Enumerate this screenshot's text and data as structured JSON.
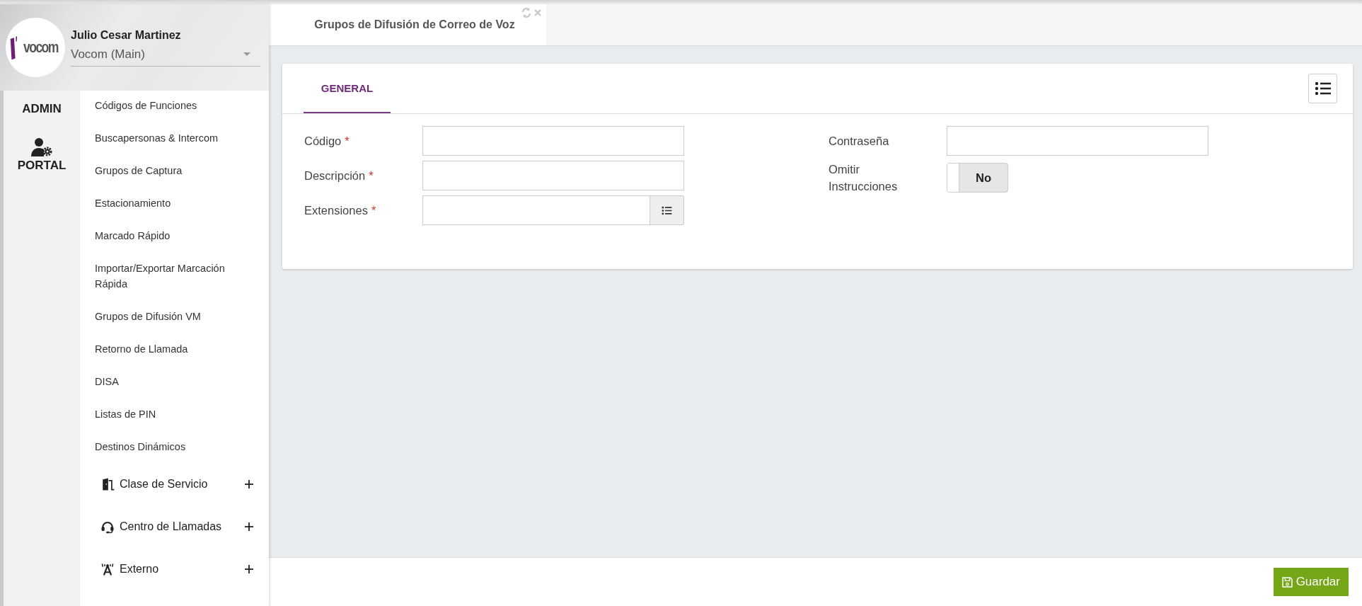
{
  "user": {
    "logo_text": "vocom",
    "name": "Julio Cesar Martinez",
    "account": "Vocom (Main)"
  },
  "rail": [
    {
      "label": "ADMIN",
      "kind": "admin"
    },
    {
      "label": "PORTAL",
      "kind": "portal"
    }
  ],
  "menu": [
    {
      "label": "Códigos de Funciones",
      "kind": "link"
    },
    {
      "label": "Buscapersonas & Intercom",
      "kind": "link"
    },
    {
      "label": "Grupos de Captura",
      "kind": "link"
    },
    {
      "label": "Estacionamiento",
      "kind": "link"
    },
    {
      "label": "Marcado Rápido",
      "kind": "link"
    },
    {
      "label": "Importar/Exportar Marcación Rápida",
      "kind": "link"
    },
    {
      "label": "Grupos de Difusión VM",
      "kind": "link"
    },
    {
      "label": "Retorno de Llamada",
      "kind": "link"
    },
    {
      "label": "DISA",
      "kind": "link"
    },
    {
      "label": "Listas de PIN",
      "kind": "link"
    },
    {
      "label": "Destinos Dinámicos",
      "kind": "link"
    },
    {
      "label": "Clase de Servicio",
      "kind": "group",
      "expanded": false
    },
    {
      "label": "Centro de Llamadas",
      "kind": "group",
      "expanded": false
    },
    {
      "label": "Externo",
      "kind": "group",
      "expanded": false
    }
  ],
  "page_tab": {
    "title": "Grupos de Difusión de Correo de Voz"
  },
  "tabs": [
    {
      "label": "GENERAL",
      "selected": true
    }
  ],
  "fields_left": [
    {
      "label": "Código",
      "required_mark": "*",
      "kind": "text"
    },
    {
      "label": "Descripción",
      "required_mark": "*",
      "kind": "text"
    },
    {
      "label": "Extensiones",
      "required_mark": "*",
      "kind": "picker"
    }
  ],
  "fields_right": [
    {
      "label": "Contraseña",
      "kind": "text"
    },
    {
      "label": "Omitir Instrucciones",
      "kind": "toggle",
      "on": false,
      "value": "No"
    }
  ],
  "save_button": "Guardar"
}
